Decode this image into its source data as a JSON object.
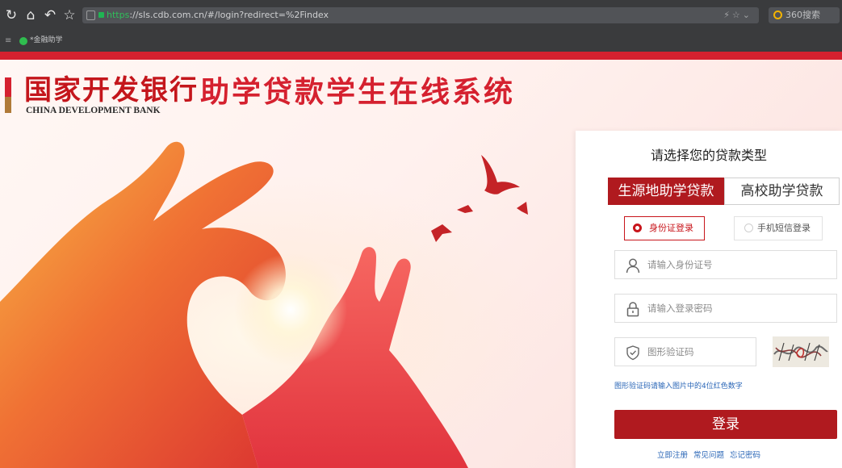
{
  "browser": {
    "url_scheme": "https",
    "url_rest": "://sls.cdb.com.cn/#/login?redirect=%2Findex",
    "search_placeholder": "360搜索",
    "bookmark_label": "*金融助学"
  },
  "header": {
    "bank_name_cn": "国家开发银行",
    "bank_name_en": "CHINA DEVELOPMENT BANK",
    "system_title": "助学贷款学生在线系统"
  },
  "login": {
    "heading": "请选择您的贷款类型",
    "loan_types": [
      "生源地助学贷款",
      "高校助学贷款"
    ],
    "methods": [
      "身份证登录",
      "手机短信登录"
    ],
    "id_placeholder": "请输入身份证号",
    "password_placeholder": "请输入登录密码",
    "captcha_placeholder": "图形验证码",
    "captcha_hint": "图形验证码请输入图片中的4位红色数字",
    "login_label": "登录",
    "links": [
      "立即注册",
      "常见问题",
      "忘记密码"
    ]
  },
  "colors": {
    "brand_red": "#b01a1f",
    "link_blue": "#2b67b7"
  }
}
